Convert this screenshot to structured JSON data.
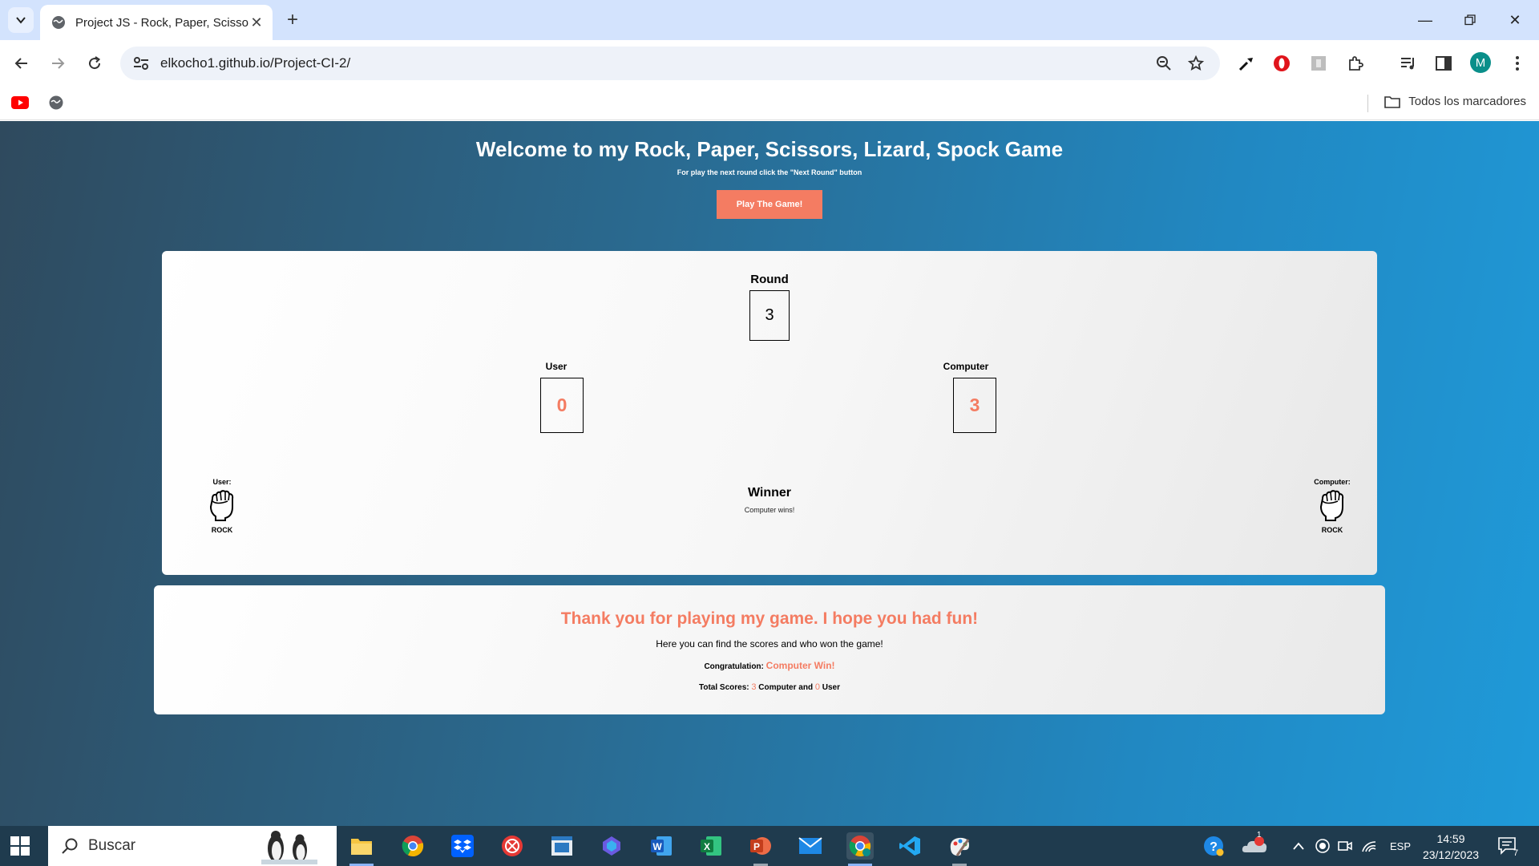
{
  "browser": {
    "tab_title": "Project JS - Rock, Paper, Scissors",
    "url": "elkocho1.github.io/Project-CI-2/",
    "bookmarks_all": "Todos los marcadores",
    "avatar_initial": "M"
  },
  "page": {
    "title": "Welcome to my Rock, Paper, Scissors, Lizard, Spock Game",
    "subtitle": "For play the next round click the \"Next Round\" button",
    "play_button": "Play The Game!",
    "round_label": "Round",
    "round_value": "3",
    "user_label": "User",
    "user_score": "0",
    "computer_label": "Computer",
    "computer_score": "3",
    "user_choice_label": "User:",
    "user_choice": "ROCK",
    "computer_choice_label": "Computer:",
    "computer_choice": "ROCK",
    "winner_label": "Winner",
    "winner_text": "Computer wins!",
    "accent_color": "#f47c62"
  },
  "summary": {
    "title": "Thank you for playing my game. I hope you had fun!",
    "subtitle": "Here you can find the scores and who won the game!",
    "congrat_label": "Congratulation:",
    "congrat_value": "Computer Win!",
    "total_label": "Total Scores:",
    "total_computer": "3",
    "computer_and": "Computer and",
    "total_user": "0",
    "user_word": "User"
  },
  "taskbar": {
    "search_placeholder": "Buscar",
    "language": "ESP",
    "time": "14:59",
    "date": "23/12/2023",
    "notifications": "7",
    "cloud_badge": "1"
  }
}
